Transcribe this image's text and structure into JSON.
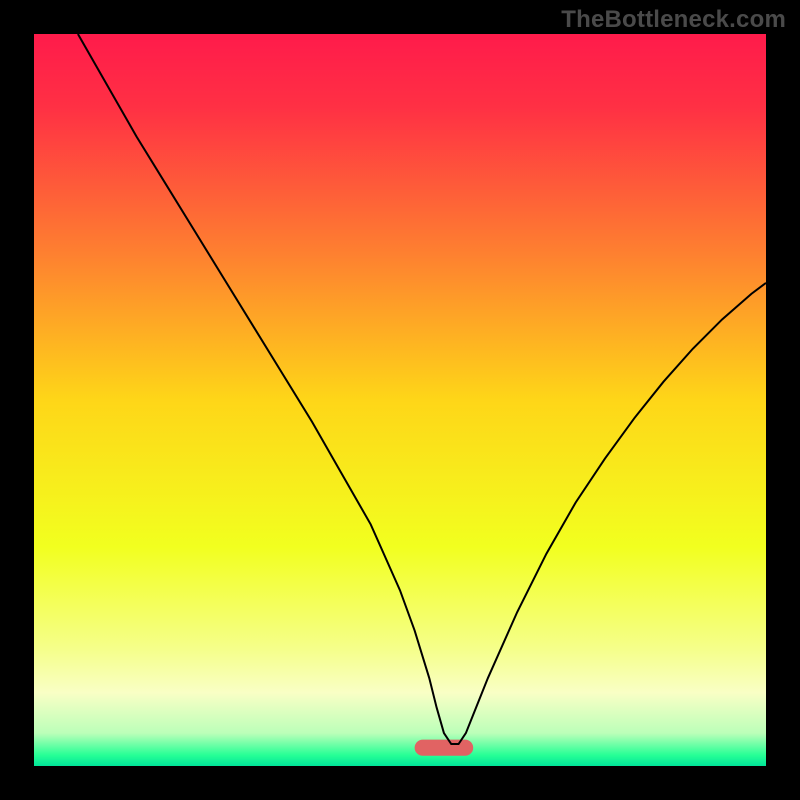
{
  "watermark": "TheBottleneck.com",
  "chart_data": {
    "type": "line",
    "title": "",
    "xlabel": "",
    "ylabel": "",
    "xlim": [
      0,
      100
    ],
    "ylim": [
      0,
      100
    ],
    "background_gradient": {
      "stops": [
        {
          "offset": 0.0,
          "color": "#ff1b4b"
        },
        {
          "offset": 0.1,
          "color": "#ff3044"
        },
        {
          "offset": 0.3,
          "color": "#fe8030"
        },
        {
          "offset": 0.5,
          "color": "#fed618"
        },
        {
          "offset": 0.7,
          "color": "#f2ff1f"
        },
        {
          "offset": 0.84,
          "color": "#f5ff8a"
        },
        {
          "offset": 0.9,
          "color": "#f9ffc5"
        },
        {
          "offset": 0.955,
          "color": "#bcffb9"
        },
        {
          "offset": 0.985,
          "color": "#27ff96"
        },
        {
          "offset": 1.0,
          "color": "#00e598"
        }
      ]
    },
    "marker": {
      "shape": "capsule",
      "x": 56,
      "y": 2.5,
      "width": 8,
      "height": 2.2,
      "color": "#e16363"
    },
    "series": [
      {
        "name": "bottleneck-curve",
        "color": "#000000",
        "stroke_width": 2,
        "x": [
          6,
          10,
          14,
          18,
          22,
          26,
          30,
          34,
          38,
          42,
          46,
          50,
          52,
          54,
          55,
          56,
          57,
          58,
          59,
          60,
          62,
          66,
          70,
          74,
          78,
          82,
          86,
          90,
          94,
          98,
          100
        ],
        "y": [
          100,
          93,
          86,
          79.5,
          73,
          66.5,
          60,
          53.5,
          47,
          40,
          33,
          24,
          18.5,
          12,
          8,
          4.5,
          3,
          3,
          4.5,
          7,
          12,
          21,
          29,
          36,
          42,
          47.5,
          52.5,
          57,
          61,
          64.5,
          66
        ]
      }
    ]
  }
}
